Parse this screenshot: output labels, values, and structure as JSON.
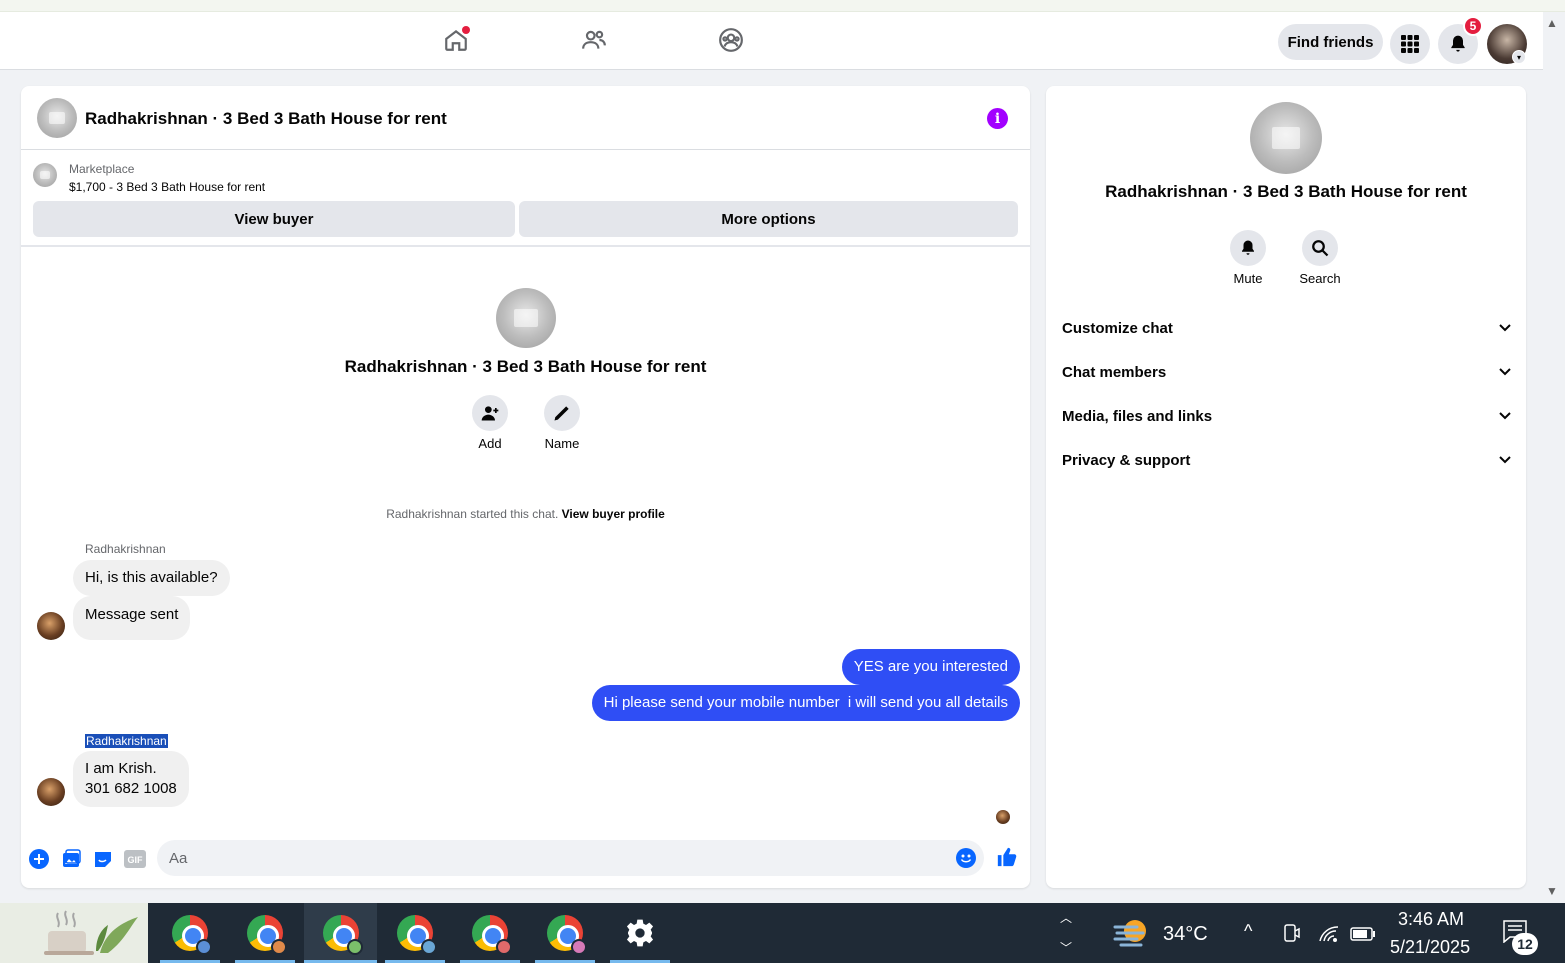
{
  "topbar": {
    "find_friends_label": "Find friends",
    "notification_count": "5"
  },
  "chat": {
    "title": "Radhakrishnan · 3 Bed 3 Bath House for rent",
    "marketplace_label": "Marketplace",
    "listing": "$1,700 - 3 Bed 3 Bath House for rent",
    "view_buyer_label": "View buyer",
    "more_options_label": "More options",
    "center_title": "Radhakrishnan · 3 Bed 3 Bath House for rent",
    "add_label": "Add",
    "name_label": "Name",
    "started_text": "Radhakrishnan started this chat.",
    "view_buyer_profile": "View buyer profile",
    "messages": [
      {
        "sender": "Radhakrishnan",
        "text": "Hi, is this available?"
      },
      {
        "text": "Message sent"
      },
      {
        "text": "YES are you interested"
      },
      {
        "text": "Hi please send your mobile number  i will send you all details"
      },
      {
        "sender": "Radhakrishnan",
        "text_line1": "I am Krish.",
        "text_line2": "301 682 1008"
      }
    ],
    "input_placeholder": "Aa"
  },
  "sidebar": {
    "title": "Radhakrishnan · 3 Bed 3 Bath House for rent",
    "mute_label": "Mute",
    "search_label": "Search",
    "sections": [
      "Customize chat",
      "Chat members",
      "Media, files and links",
      "Privacy & support"
    ]
  },
  "taskbar": {
    "temperature": "34°C",
    "time": "3:46 AM",
    "date": "5/21/2025",
    "notif_count": "12"
  },
  "colors": {
    "accent": "#0866ff",
    "outgoing_bubble": "#2f4ef5",
    "info": "#a200ff",
    "badge": "#e41e3f"
  }
}
